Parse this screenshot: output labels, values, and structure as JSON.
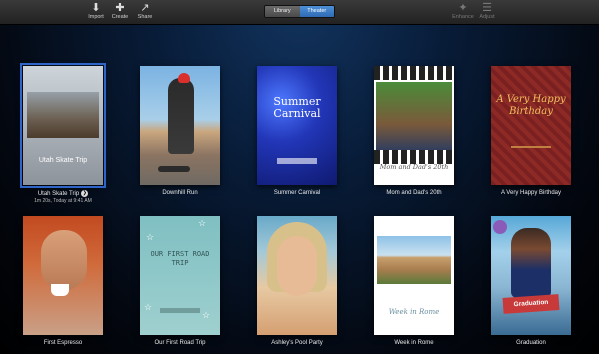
{
  "toolbar": {
    "import_label": "Import",
    "create_label": "Create",
    "share_label": "Share",
    "enhance_label": "Enhance",
    "adjust_label": "Adjust",
    "segment": {
      "library": "Library",
      "theater": "Theater",
      "selected": "Theater"
    },
    "icons": {
      "import": "import-icon",
      "create": "plus-icon",
      "share": "share-icon",
      "enhance": "magic-wand-icon",
      "adjust": "sliders-icon"
    }
  },
  "projects": [
    {
      "name": "Utah Skate Trip",
      "thumb_title": "Utah Skate Trip",
      "date": "1m 20s, Today at 9:41 AM",
      "selected": true
    },
    {
      "name": "Downhill Run"
    },
    {
      "name": "Summer Carnival",
      "thumb_title": "Summer Carnival"
    },
    {
      "name": "Mom and Dad's 20th",
      "thumb_title": "Mom and Dad's 20th"
    },
    {
      "name": "A Very Happy Birthday",
      "thumb_title": "A Very Happy Birthday"
    },
    {
      "name": "First Espresso"
    },
    {
      "name": "Our First Road Trip",
      "thumb_title": "OUR FIRST ROAD TRIP"
    },
    {
      "name": "Ashley's Pool Party"
    },
    {
      "name": "Week in Rome",
      "thumb_title": "Week in Rome"
    },
    {
      "name": "Graduation",
      "thumb_title": "Graduation"
    }
  ],
  "colors": {
    "accent": "#2f64c8",
    "toolbar": "#2c2c2c",
    "background": "#081c38"
  }
}
